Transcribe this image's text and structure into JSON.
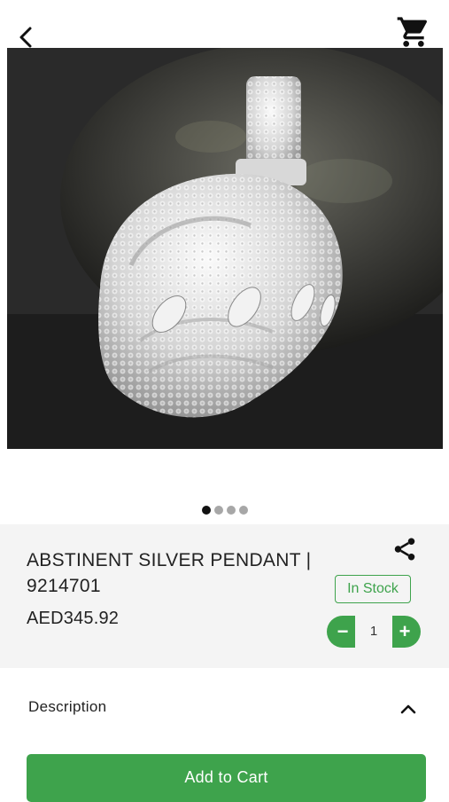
{
  "header": {
    "back_icon": "chevron-left-icon",
    "cart_icon": "shopping-cart-icon"
  },
  "gallery": {
    "image_subject": "silver-pendant-photo",
    "page_count": 4,
    "active_page": 1
  },
  "product": {
    "title": "ABSTINENT SILVER PENDANT | 9214701",
    "price": "AED345.92",
    "stock_status": "In Stock",
    "quantity": "1"
  },
  "actions": {
    "share_icon": "share-icon",
    "minus_label": "−",
    "plus_label": "+"
  },
  "description": {
    "label": "Description",
    "toggle_icon": "chevron-up-icon"
  },
  "footer": {
    "add_to_cart_label": "Add to Cart"
  },
  "colors": {
    "accent": "#3ea34c",
    "info_bg": "#f4f4f4"
  }
}
